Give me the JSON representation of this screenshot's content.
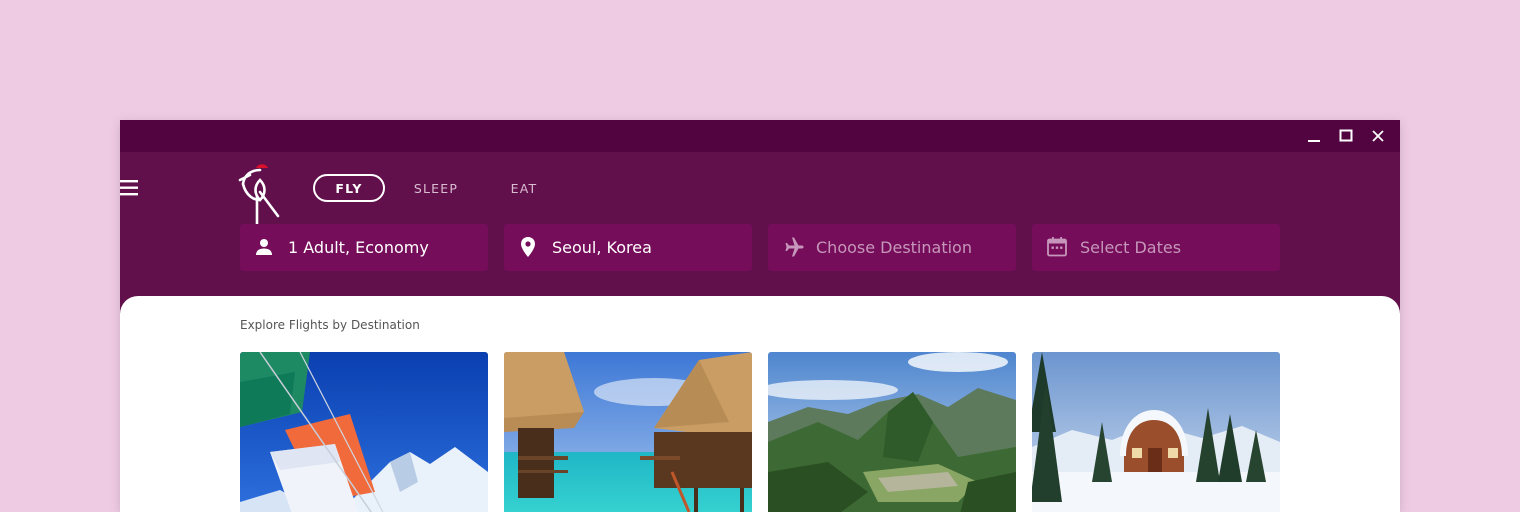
{
  "window": {
    "controls": {
      "minimize": "minimize-icon",
      "maximize": "maximize-icon",
      "close": "close-icon"
    }
  },
  "header": {
    "menu_icon": "hamburger-menu-icon",
    "logo_icon": "crane-logo-icon",
    "tabs": [
      {
        "label": "FLY",
        "active": true
      },
      {
        "label": "SLEEP",
        "active": false
      },
      {
        "label": "EAT",
        "active": false
      }
    ]
  },
  "search": {
    "passengers": {
      "icon": "person-icon",
      "value": "1 Adult, Economy"
    },
    "origin": {
      "icon": "location-pin-icon",
      "value": "Seoul, Korea"
    },
    "destination": {
      "icon": "airplane-icon",
      "placeholder": "Choose Destination"
    },
    "dates": {
      "icon": "calendar-icon",
      "placeholder": "Select Dates"
    }
  },
  "explore": {
    "title": "Explore Flights by Destination",
    "cards": [
      {
        "image": "prayer-flags-mountain-photo"
      },
      {
        "image": "overwater-bungalows-photo"
      },
      {
        "image": "machu-picchu-photo"
      },
      {
        "image": "snowy-cabin-photo"
      }
    ]
  },
  "colors": {
    "page_background": "#efcbe3",
    "titlebar": "#510440",
    "header": "#62104b",
    "field": "#760d5a",
    "logo_accent": "#d8102b",
    "content": "#ffffff"
  }
}
